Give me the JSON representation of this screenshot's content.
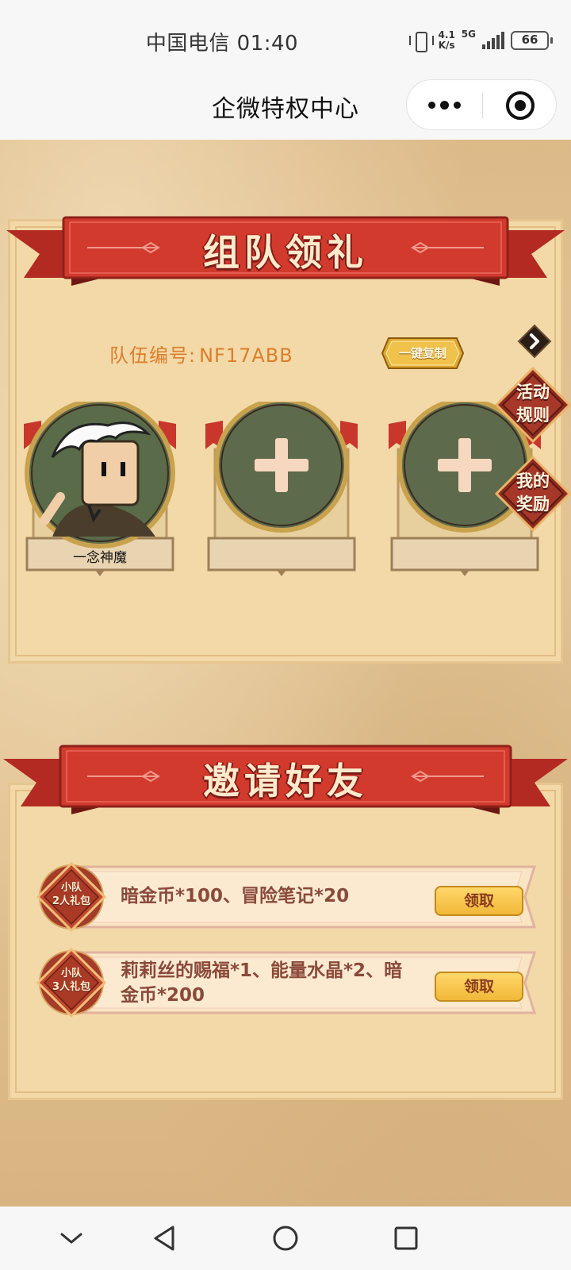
{
  "status_bar": {
    "carrier_time": "中国电信 01:40",
    "speed_top": "4.1",
    "speed_bottom": "K/s",
    "network": "5G",
    "battery": "66"
  },
  "title_bar": {
    "title": "企微特权中心"
  },
  "team_section": {
    "banner": "组队领礼",
    "team_no_label": "队伍编号:",
    "team_no_value": "NF17ABB",
    "copy_button": "一键复制",
    "members": [
      {
        "name": "一念神魔",
        "filled": true
      },
      {
        "name": "",
        "filled": false
      },
      {
        "name": "",
        "filled": false
      }
    ]
  },
  "side_badges": {
    "rules": "活动\n规则",
    "rewards": "我的\n奖励"
  },
  "invite_section": {
    "banner": "邀请好友",
    "gifts": [
      {
        "tag_line1": "小队",
        "tag_line2": "2人礼包",
        "desc": "暗金币*100、冒险笔记*20",
        "button": "领取"
      },
      {
        "tag_line1": "小队",
        "tag_line2": "3人礼包",
        "desc": "莉莉丝的赐福*1、能量水晶*2、暗金币*200",
        "button": "领取"
      }
    ]
  },
  "colors": {
    "ribbon_red": "#d23a2e",
    "team_no_orange": "#dc7d2b",
    "slot_green": "#5d6a4c",
    "claim_yellow": "#f6c849"
  }
}
